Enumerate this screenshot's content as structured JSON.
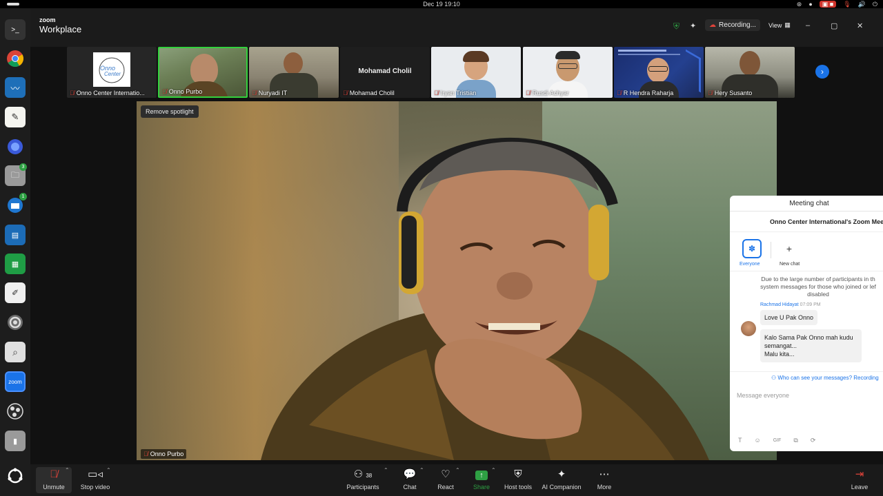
{
  "system": {
    "clock": "Dec 19  19:10"
  },
  "zoom": {
    "brand_small": "zoom",
    "brand_big": "Workplace",
    "recording_label": "Recording...",
    "view_label": "View"
  },
  "participants_strip": [
    {
      "name": "Onno Center Internatio...",
      "kind": "logo"
    },
    {
      "name": "Onno Purbo",
      "kind": "video",
      "active": true
    },
    {
      "name": "Nuryadi IT",
      "kind": "video"
    },
    {
      "name": "Mohamad Cholil",
      "kind": "name",
      "center_name": "Mohamad Cholil"
    },
    {
      "name": "Iryan Tristian",
      "kind": "avatar"
    },
    {
      "name": "Rusdi Achyar",
      "kind": "avatar"
    },
    {
      "name": "R Hendra Raharja",
      "kind": "slide"
    },
    {
      "name": "Hery Susanto",
      "kind": "video"
    }
  ],
  "main": {
    "spotlight_button": "Remove spotlight",
    "speaker_name": "Onno Purbo"
  },
  "chat": {
    "title": "Meeting chat",
    "meeting_name": "Onno Center International's Zoom Meeti",
    "tab_everyone": "Everyone",
    "tab_new_chat": "New chat",
    "system_message_1": "Due to the large number of participants in th",
    "system_message_2": "system messages for those who joined or lef",
    "system_message_3": "disabled",
    "sender": "Rachmad Hidayat",
    "sender_time": "07:09 PM",
    "message_1": "Love U Pak Onno",
    "message_2_line1": "Kalo Sama Pak Onno mah kudu",
    "message_2_line2": "semangat...",
    "message_2_line3": "Malu kita...",
    "who_can_see": "Who can see your messages? Recording",
    "input_placeholder": "Message everyone"
  },
  "toolbar": {
    "unmute": "Unmute",
    "stop_video": "Stop video",
    "participants": "Participants",
    "participants_count": "38",
    "chat": "Chat",
    "react": "React",
    "share": "Share",
    "host_tools": "Host tools",
    "ai_companion": "AI Companion",
    "more": "More",
    "leave": "Leave"
  },
  "colors": {
    "accent": "#1a73e8",
    "active_border": "#33d13d",
    "share_green": "#2ea043",
    "muted_red": "#e0433a"
  },
  "dock": [
    {
      "icon": "terminal-icon"
    },
    {
      "icon": "chrome-icon"
    },
    {
      "icon": "monitor-icon"
    },
    {
      "icon": "text-editor-icon"
    },
    {
      "icon": "firefox-icon"
    },
    {
      "icon": "files-icon",
      "badge": "3"
    },
    {
      "icon": "thunderbird-icon",
      "badge": "1"
    },
    {
      "icon": "writer-icon"
    },
    {
      "icon": "calc-icon"
    },
    {
      "icon": "notes-icon"
    },
    {
      "icon": "settings-icon"
    },
    {
      "icon": "search-icon"
    },
    {
      "icon": "zoom-icon",
      "label": "zoom"
    },
    {
      "icon": "obs-icon"
    },
    {
      "icon": "usb-drive-icon"
    },
    {
      "icon": "ubuntu-apps-icon"
    }
  ]
}
